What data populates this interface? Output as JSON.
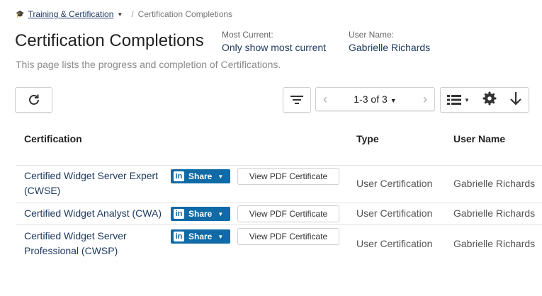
{
  "breadcrumb": {
    "parent": "Training & Certification",
    "current": "Certification Completions"
  },
  "page": {
    "title": "Certification Completions",
    "description": "This page lists the progress and completion of Certifications."
  },
  "filters": [
    {
      "label": "Most Current:",
      "value": "Only show most current"
    },
    {
      "label": "User Name:",
      "value": "Gabrielle Richards"
    }
  ],
  "toolbar": {
    "pager_label": "1-3 of 3",
    "icons": [
      "refresh-icon",
      "filter-icon",
      "chevron-left-icon",
      "chevron-right-icon",
      "list-view-icon",
      "gear-icon",
      "download-arrow-icon"
    ]
  },
  "table": {
    "columns": [
      "Certification",
      "Type",
      "User Name"
    ],
    "rows": [
      {
        "certification": "Certified Widget Server Expert (CWSE)",
        "share_label": "Share",
        "pdf_label": "View PDF Certificate",
        "type": "User Certification",
        "user": "Gabrielle Richards"
      },
      {
        "certification": "Certified Widget Analyst (CWA)",
        "share_label": "Share",
        "pdf_label": "View PDF Certificate",
        "type": "User Certification",
        "user": "Gabrielle Richards"
      },
      {
        "certification": "Certified Widget Server Professional (CWSP)",
        "share_label": "Share",
        "pdf_label": "View PDF Certificate",
        "type": "User Certification",
        "user": "Gabrielle Richards"
      }
    ]
  },
  "colors": {
    "link": "#1f3a60",
    "linkedin": "#0f6aa6"
  }
}
